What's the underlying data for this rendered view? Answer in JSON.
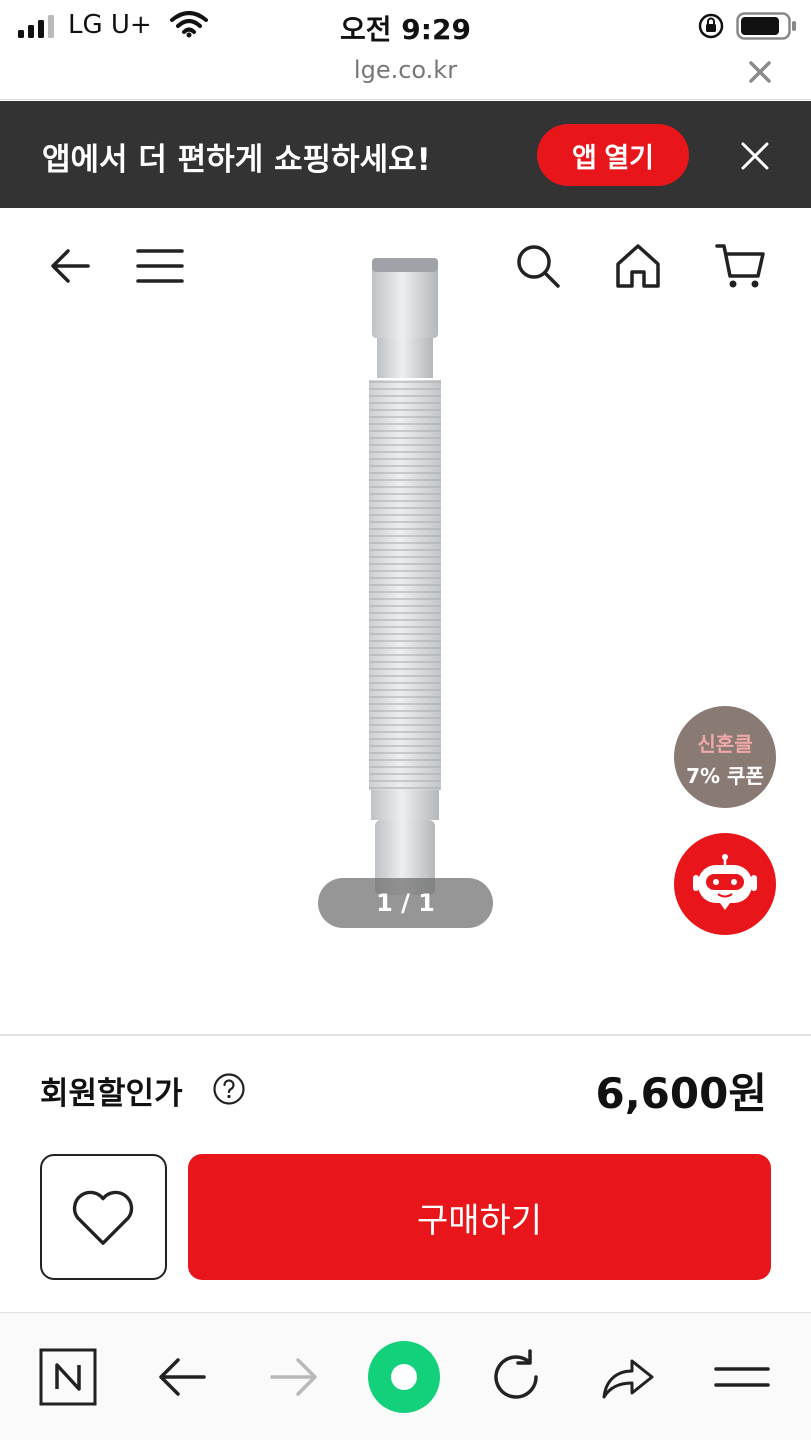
{
  "status_bar": {
    "carrier": "LG U+",
    "time": "오전 9:29"
  },
  "url_bar": {
    "url": "lge.co.kr"
  },
  "app_banner": {
    "text": "앱에서 더 편하게 쇼핑하세요!",
    "open_button": "앱 열기"
  },
  "product": {
    "image_pager": "1 / 1",
    "coupon_top": "신혼클",
    "coupon_bottom": "7% 쿠폰"
  },
  "price_section": {
    "label": "회원할인가",
    "price": "6,600원"
  },
  "actions": {
    "buy_label": "구매하기"
  },
  "colors": {
    "brand_red": "#e8161b",
    "banner_bg": "#333333"
  },
  "icons": [
    "signal-icon",
    "wifi-icon",
    "rotation-lock-icon",
    "battery-icon",
    "close-icon",
    "back-arrow-icon",
    "menu-icon",
    "search-icon",
    "home-icon",
    "cart-icon",
    "help-icon",
    "heart-icon",
    "naver-icon",
    "forward-arrow-icon",
    "green-dot-icon",
    "refresh-icon",
    "share-icon",
    "chatbot-icon"
  ]
}
